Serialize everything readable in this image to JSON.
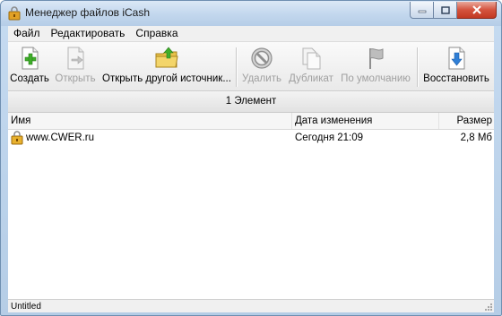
{
  "window": {
    "title": "Менеджер файлов iCash"
  },
  "menu": {
    "items": [
      "Файл",
      "Редактировать",
      "Справка"
    ]
  },
  "toolbar": {
    "create": "Создать",
    "open": "Открыть",
    "open_other_source": "Открыть другой источник...",
    "delete": "Удалить",
    "duplicate": "Дубликат",
    "default": "По умолчанию",
    "restore": "Восстановить"
  },
  "count_label": "1 Элемент",
  "columns": {
    "name": "Имя",
    "date": "Дата изменения",
    "size": "Размер"
  },
  "files": [
    {
      "name": "www.CWER.ru",
      "date": "Сегодня 21:09",
      "size": "2,8 Мб",
      "icon": "locked-file-icon"
    }
  ],
  "status": "Untitled",
  "colors": {
    "accent_green": "#3fae2a",
    "restore_blue": "#2f7fd6",
    "disabled_gray": "#a0a0a0",
    "folder_yellow": "#e8c24a"
  }
}
